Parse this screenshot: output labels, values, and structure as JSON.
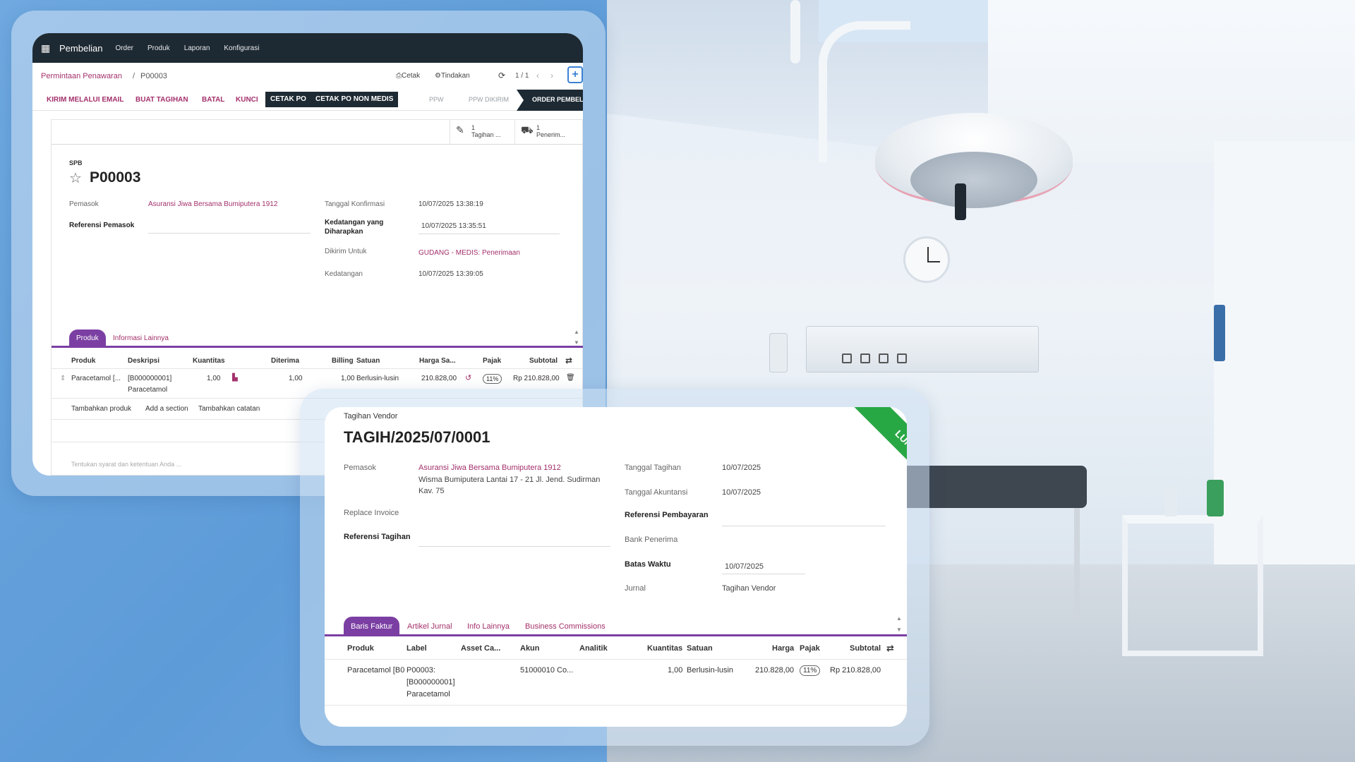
{
  "purchase_order": {
    "navbar": {
      "brand": "Pembelian",
      "menu": [
        "Order",
        "Produk",
        "Laporan",
        "Konfigurasi"
      ]
    },
    "breadcrumb": {
      "parent": "Permintaan Penawaran",
      "separator": "/",
      "current": "P00003"
    },
    "actions": {
      "print": "Cetak",
      "action": "Tindakan",
      "pager": "1 / 1",
      "new": "+"
    },
    "buttons": {
      "send_email": "KIRIM MELALUI EMAIL",
      "create_bill": "BUAT TAGIHAN",
      "cancel": "BATAL",
      "lock": "KUNCI",
      "print_po": "CETAK PO",
      "print_po_non_medis": "CETAK PO NON MEDIS"
    },
    "statusbar": [
      "PPW",
      "PPW DIKIRIM",
      "ORDER PEMBELIAN"
    ],
    "smart_buttons": [
      {
        "count": "1",
        "label": "Tagihan ...",
        "icon": "edit-icon"
      },
      {
        "count": "1",
        "label": "Penerim...",
        "icon": "truck-icon"
      }
    ],
    "doc_type": "SPB",
    "name": "P00003",
    "fields": {
      "supplier_label": "Pemasok",
      "supplier_value": "Asuransi Jiwa Bersama Bumiputera 1912",
      "supplier_ref_label": "Referensi Pemasok",
      "confirm_date_label": "Tanggal Konfirmasi",
      "confirm_date_value": "10/07/2025 13:38:19",
      "expected_label_1": "Kedatangan yang",
      "expected_label_2": "Diharapkan",
      "expected_value": "10/07/2025 13:35:51",
      "deliver_to_label": "Dikirim Untuk",
      "deliver_to_value": "GUDANG - MEDIS: Penerimaan",
      "arrival_label": "Kedatangan",
      "arrival_value": "10/07/2025 13:39:05"
    },
    "tabs": [
      "Produk",
      "Informasi Lainnya"
    ],
    "table": {
      "headers": [
        "Produk",
        "Deskripsi",
        "Kuantitas",
        "Diterima",
        "Billing",
        "Satuan",
        "Harga Sa...",
        "Pajak",
        "Subtotal"
      ],
      "row": {
        "product": "Paracetamol [...",
        "desc_1": "[B000000001]",
        "desc_2": "Paracetamol",
        "qty": "1,00",
        "received": "1,00",
        "billed": "1,00",
        "uom": "Berlusin-lusin",
        "price": "210.828,00",
        "tax": "11%",
        "subtotal": "Rp 210.828,00"
      },
      "add_links": [
        "Tambahkan produk",
        "Add a section",
        "Tambahkan catatan"
      ]
    },
    "terms_placeholder": "Tentukan syarat dan ketentuan Anda ..."
  },
  "vendor_bill": {
    "doc_type": "Tagihan Vendor",
    "name": "TAGIH/2025/07/0001",
    "ribbon": "LUNAS",
    "fields": {
      "supplier_label": "Pemasok",
      "supplier_value": "Asuransi Jiwa Bersama Bumiputera 1912",
      "supplier_address_1": "Wisma Bumiputera Lantai 17 - 21 Jl. Jend. Sudirman",
      "supplier_address_2": "Kav. 75",
      "replace_invoice_label": "Replace Invoice",
      "bill_ref_label": "Referensi Tagihan",
      "bill_date_label": "Tanggal Tagihan",
      "bill_date_value": "10/07/2025",
      "acct_date_label": "Tanggal Akuntansi",
      "acct_date_value": "10/07/2025",
      "payment_ref_label": "Referensi Pembayaran",
      "bank_label": "Bank Penerima",
      "due_label": "Batas Waktu",
      "due_value": "10/07/2025",
      "journal_label": "Jurnal",
      "journal_value": "Tagihan Vendor"
    },
    "tabs": [
      "Baris Faktur",
      "Artikel Jurnal",
      "Info Lainnya",
      "Business Commissions"
    ],
    "table": {
      "headers": [
        "Produk",
        "Label",
        "Asset Ca...",
        "Akun",
        "Analitik",
        "Kuantitas",
        "Satuan",
        "Harga",
        "Pajak",
        "Subtotal"
      ],
      "row": {
        "product": "Paracetamol [B0",
        "label_1": "P00003:",
        "label_2": "[B000000001]",
        "label_3": "Paracetamol",
        "account": "51000010 Co...",
        "qty": "1,00",
        "uom": "Berlusin-lusin",
        "price": "210.828,00",
        "tax": "11%",
        "subtotal": "Rp 210.828,00"
      }
    }
  },
  "colors": {
    "accent": "#7b3fa3",
    "link": "#a3306b",
    "navbar": "#1e2a33",
    "paid": "#28a745",
    "background": "#6fa9e0"
  }
}
